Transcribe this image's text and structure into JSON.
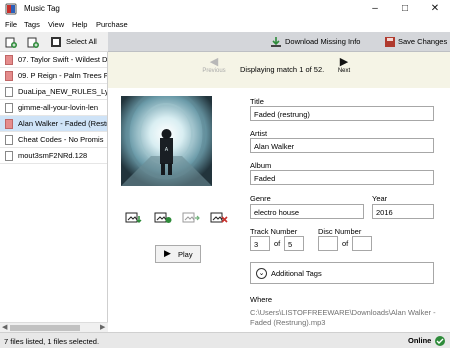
{
  "window": {
    "title": "Music Tag"
  },
  "menu": [
    "File",
    "Tags",
    "View",
    "Help",
    "Purchase"
  ],
  "toolbar": {
    "select_all": "Select All"
  },
  "actions": {
    "download_missing": "Download Missing Info",
    "save_changes": "Save Changes"
  },
  "files": [
    {
      "name": "07. Taylor Swift - Wildest D",
      "icon": "red"
    },
    {
      "name": "09. P Reign - Palm Trees F",
      "icon": "red"
    },
    {
      "name": "DuaLipa_NEW_RULES_Lyri",
      "icon": "white"
    },
    {
      "name": "gimme-all-your-lovin-len",
      "icon": "white"
    },
    {
      "name": "Alan Walker - Faded (Restr",
      "icon": "red"
    },
    {
      "name": "Cheat Codes - No Promis",
      "icon": "white"
    },
    {
      "name": "mout3smF2NRd.128",
      "icon": "white"
    }
  ],
  "nav": {
    "previous": "Previous",
    "next": "Next",
    "match_text": "Displaying match 1 of 52."
  },
  "player": {
    "play": "Play"
  },
  "labels": {
    "title": "Title",
    "artist": "Artist",
    "album": "Album",
    "genre": "Genre",
    "year": "Year",
    "track": "Track Number",
    "disc": "Disc Number",
    "of": "of",
    "additional_tags": "Additional Tags",
    "where": "Where"
  },
  "tags": {
    "title": "Faded (restrung)",
    "artist": "Alan Walker",
    "album": "Faded",
    "genre": "electro house",
    "year": "2016",
    "track": "3",
    "track_total": "5",
    "disc": "",
    "disc_total": ""
  },
  "where_path": "C:\\Users\\LISTOFFREEWARE\\Downloads\\Alan Walker - Faded (Restrung).mp3",
  "status": {
    "text": "7 files listed,  1 files selected.",
    "online": "Online"
  },
  "colors": {
    "selected_row": "#cfe3f7",
    "nav_bg": "#f5f4e6",
    "toolbar_bg": "#d4d6da",
    "accent_green": "#2e8b3a",
    "file_red": "#e58c8c"
  },
  "icons": [
    "music-tag-app-icon",
    "add-file-icon",
    "add-folder-icon",
    "select-all-icon",
    "download-icon",
    "save-icon",
    "next-arrow-icon",
    "previous-arrow-icon",
    "play-icon",
    "online-icon"
  ]
}
